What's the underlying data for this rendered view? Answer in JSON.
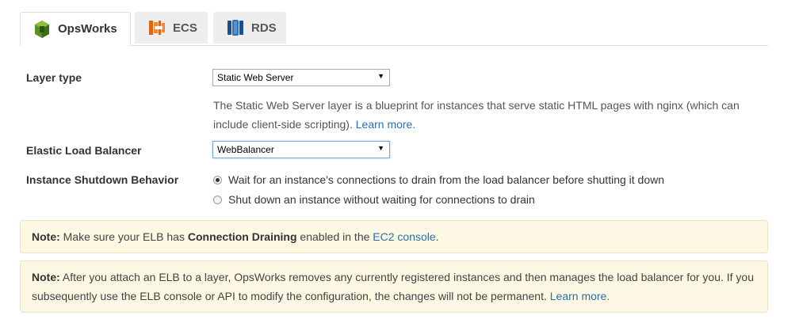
{
  "tabs": [
    {
      "label": "OpsWorks",
      "icon": "opsworks-icon",
      "active": true
    },
    {
      "label": "ECS",
      "icon": "ecs-icon",
      "active": false
    },
    {
      "label": "RDS",
      "icon": "rds-icon",
      "active": false
    }
  ],
  "form": {
    "layer_type": {
      "label": "Layer type",
      "value": "Static Web Server",
      "description": "The Static Web Server layer is a blueprint for instances that serve static HTML pages with nginx (which can include client-side scripting).",
      "learn_more": "Learn more."
    },
    "elb": {
      "label": "Elastic Load Balancer",
      "value": "WebBalancer"
    },
    "shutdown": {
      "label": "Instance Shutdown Behavior",
      "options": [
        {
          "label": "Wait for an instance's connections to drain from the load balancer before shutting it down",
          "checked": true
        },
        {
          "label": "Shut down an instance without waiting for connections to drain",
          "checked": false
        }
      ]
    }
  },
  "notes": {
    "note1": {
      "prefix": "Note:",
      "text1": "Make sure your ELB has",
      "bold": "Connection Draining",
      "text2": "enabled in the",
      "link": "EC2 console",
      "end": "."
    },
    "note2": {
      "prefix": "Note:",
      "text": "After you attach an ELB to a layer, OpsWorks removes any currently registered instances and then manages the load balancer for you. If you subsequently use the ELB console or API to modify the configuration, the changes will not be permanent.",
      "link": "Learn more."
    }
  },
  "colors": {
    "link": "#2a6fb0",
    "note_background": "#fcf8e3",
    "opsworks_green": "#3f7a1f",
    "ecs_orange": "#e07b2a",
    "rds_blue": "#2d5f9e"
  }
}
